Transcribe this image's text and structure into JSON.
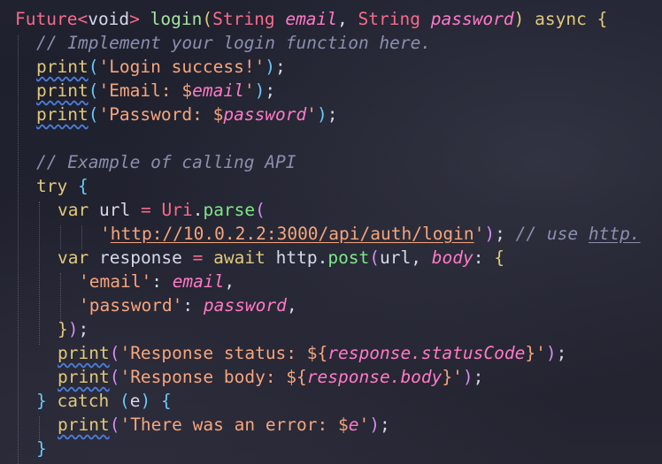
{
  "editor": {
    "language": "dart",
    "line_texts": [
      "Future<void> login(String email, String password) async {",
      "// Implement your login function here.",
      "print('Login success!');",
      "print('Email: $email');",
      "print('Password: $password');",
      "",
      "// Example of calling API",
      "try {",
      "var url = Uri.parse(",
      "'http://10.0.2.2:3000/api/auth/login'); // use http.",
      "var response = await http.post(url, body: {",
      "'email': email,",
      "'password': password,",
      "});",
      "print('Response status: ${response.statusCode}');",
      "print('Response body: ${response.body}');",
      "} catch (e) {",
      "print('There was an error: $e');",
      "}"
    ],
    "tokens": {
      "future": "Future",
      "lt": "<",
      "void": "void",
      "gt": ">",
      "login": "login",
      "open_paren": "(",
      "string_type": "String",
      "email_param": "email",
      "comma": ",",
      "password_param": "password",
      "close_paren": ")",
      "async": "async",
      "open_brace": "{",
      "close_brace": "}",
      "comment_implement": "// Implement your login function here.",
      "print": "print",
      "str_login_success": "'Login success!'",
      "semicolon": ";",
      "str_email_prefix": "'Email: ",
      "dollar": "$",
      "email_var": "email",
      "quote": "'",
      "str_password_prefix": "'Password: ",
      "password_var": "password",
      "comment_example": "// Example of calling API",
      "try": "try",
      "var": "var",
      "url": "url",
      "equals": "=",
      "uri": "Uri",
      "dot": ".",
      "parse": "parse",
      "url_literal": "http://10.0.2.2:3000/api/auth/login",
      "comment_use_prefix": "// use ",
      "comment_use_link": "http.",
      "response": "response",
      "await": "await",
      "http": "http",
      "post": "post",
      "body_label": "body",
      "colon": ":",
      "key_email": "'email'",
      "key_password": "'password'",
      "close_brace_paren_semi_brace": "}",
      "str_response_status_prefix": "'Response status: ",
      "interp_open": "${",
      "response_statuscode": "response.statusCode",
      "interp_close": "}",
      "str_response_body_prefix": "'Response body: ",
      "response_body": "response.body",
      "catch": "catch",
      "e": "e",
      "str_error_prefix": "'There was an error: ",
      "e_var": "e"
    }
  }
}
